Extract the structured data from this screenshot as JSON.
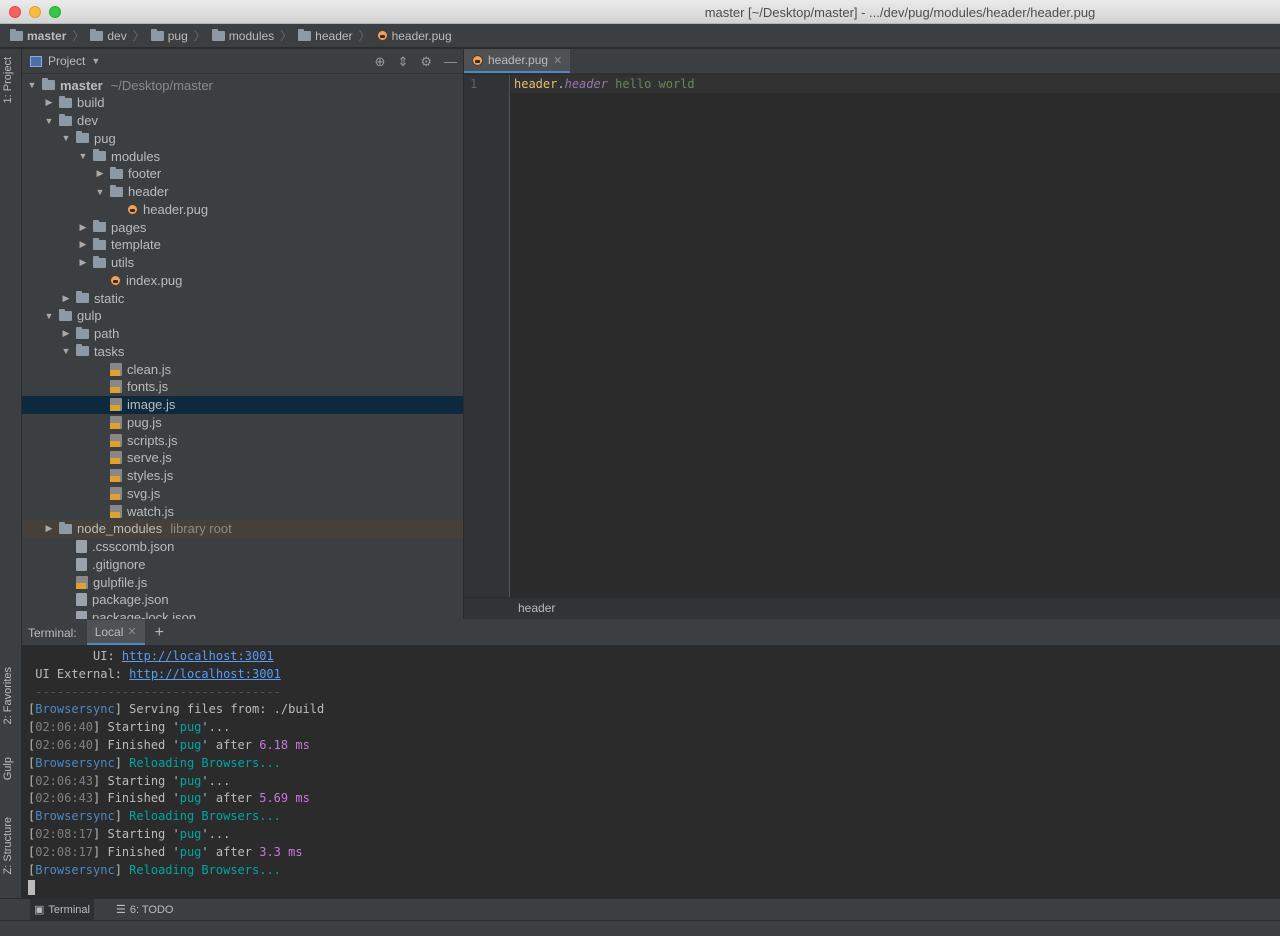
{
  "window": {
    "title": "master [~/Desktop/master] - .../dev/pug/modules/header/header.pug"
  },
  "breadcrumbs": [
    "master",
    "dev",
    "pug",
    "modules",
    "header",
    "header.pug"
  ],
  "left_tabs": {
    "project": "1: Project",
    "favorites": "2: Favorites",
    "gulp": "Gulp",
    "structure": "Z: Structure"
  },
  "project_pane": {
    "title": "Project"
  },
  "tree": [
    {
      "label": "master",
      "extra": "~/Desktop/master",
      "depth": 0,
      "kind": "folder",
      "open": true,
      "bold": true
    },
    {
      "label": "build",
      "depth": 1,
      "kind": "folder",
      "open": false
    },
    {
      "label": "dev",
      "depth": 1,
      "kind": "folder",
      "open": true
    },
    {
      "label": "pug",
      "depth": 2,
      "kind": "folder",
      "open": true
    },
    {
      "label": "modules",
      "depth": 3,
      "kind": "folder",
      "open": true
    },
    {
      "label": "footer",
      "depth": 4,
      "kind": "folder",
      "open": false
    },
    {
      "label": "header",
      "depth": 4,
      "kind": "folder",
      "open": true
    },
    {
      "label": "header.pug",
      "depth": 5,
      "kind": "pug"
    },
    {
      "label": "pages",
      "depth": 3,
      "kind": "folder",
      "open": false
    },
    {
      "label": "template",
      "depth": 3,
      "kind": "folder",
      "open": false
    },
    {
      "label": "utils",
      "depth": 3,
      "kind": "folder",
      "open": false
    },
    {
      "label": "index.pug",
      "depth": 4,
      "kind": "pug"
    },
    {
      "label": "static",
      "depth": 2,
      "kind": "folder",
      "open": false
    },
    {
      "label": "gulp",
      "depth": 1,
      "kind": "folder",
      "open": true
    },
    {
      "label": "path",
      "depth": 2,
      "kind": "folder",
      "open": false
    },
    {
      "label": "tasks",
      "depth": 2,
      "kind": "folder",
      "open": true
    },
    {
      "label": "clean.js",
      "depth": 4,
      "kind": "js"
    },
    {
      "label": "fonts.js",
      "depth": 4,
      "kind": "js"
    },
    {
      "label": "image.js",
      "depth": 4,
      "kind": "js",
      "selected": true
    },
    {
      "label": "pug.js",
      "depth": 4,
      "kind": "js"
    },
    {
      "label": "scripts.js",
      "depth": 4,
      "kind": "js"
    },
    {
      "label": "serve.js",
      "depth": 4,
      "kind": "js"
    },
    {
      "label": "styles.js",
      "depth": 4,
      "kind": "js"
    },
    {
      "label": "svg.js",
      "depth": 4,
      "kind": "js"
    },
    {
      "label": "watch.js",
      "depth": 4,
      "kind": "js"
    },
    {
      "label": "node_modules",
      "extra": "library root",
      "depth": 1,
      "kind": "folder",
      "open": false,
      "library": true
    },
    {
      "label": ".csscomb.json",
      "depth": 2,
      "kind": "file"
    },
    {
      "label": ".gitignore",
      "depth": 2,
      "kind": "file"
    },
    {
      "label": "gulpfile.js",
      "depth": 2,
      "kind": "js"
    },
    {
      "label": "package.json",
      "depth": 2,
      "kind": "file"
    },
    {
      "label": "package-lock.json",
      "depth": 2,
      "kind": "file"
    }
  ],
  "editor": {
    "tab": "header.pug",
    "line_number": "1",
    "code": {
      "tag": "header",
      "dot": ".",
      "cls": "header",
      "text": " hello world"
    },
    "status": "header"
  },
  "terminal": {
    "label": "Terminal:",
    "tab": "Local",
    "lines": [
      {
        "segs": [
          {
            "t": "         UI: ",
            "c": ""
          },
          {
            "t": "http://localhost:3001",
            "c": "lnk"
          }
        ]
      },
      {
        "segs": [
          {
            "t": " UI External: ",
            "c": ""
          },
          {
            "t": "http://localhost:3001",
            "c": "lnk"
          }
        ]
      },
      {
        "segs": [
          {
            "t": " ----------------------------------",
            "c": "gry"
          }
        ]
      },
      {
        "segs": [
          {
            "t": "[",
            "c": ""
          },
          {
            "t": "Browsersync",
            "c": "bs"
          },
          {
            "t": "] Serving files from: ./build",
            "c": ""
          }
        ]
      },
      {
        "segs": [
          {
            "t": "[",
            "c": ""
          },
          {
            "t": "02:06:40",
            "c": "ts"
          },
          {
            "t": "] Starting '",
            "c": ""
          },
          {
            "t": "pug",
            "c": "tq"
          },
          {
            "t": "'...",
            "c": ""
          }
        ]
      },
      {
        "segs": [
          {
            "t": "[",
            "c": ""
          },
          {
            "t": "02:06:40",
            "c": "ts"
          },
          {
            "t": "] Finished '",
            "c": ""
          },
          {
            "t": "pug",
            "c": "tq"
          },
          {
            "t": "' after ",
            "c": ""
          },
          {
            "t": "6.18 ms",
            "c": "num"
          }
        ]
      },
      {
        "segs": [
          {
            "t": "[",
            "c": ""
          },
          {
            "t": "Browsersync",
            "c": "bs"
          },
          {
            "t": "] ",
            "c": ""
          },
          {
            "t": "Reloading Browsers...",
            "c": "tq"
          }
        ]
      },
      {
        "segs": [
          {
            "t": "[",
            "c": ""
          },
          {
            "t": "02:06:43",
            "c": "ts"
          },
          {
            "t": "] Starting '",
            "c": ""
          },
          {
            "t": "pug",
            "c": "tq"
          },
          {
            "t": "'...",
            "c": ""
          }
        ]
      },
      {
        "segs": [
          {
            "t": "[",
            "c": ""
          },
          {
            "t": "02:06:43",
            "c": "ts"
          },
          {
            "t": "] Finished '",
            "c": ""
          },
          {
            "t": "pug",
            "c": "tq"
          },
          {
            "t": "' after ",
            "c": ""
          },
          {
            "t": "5.69 ms",
            "c": "num"
          }
        ]
      },
      {
        "segs": [
          {
            "t": "[",
            "c": ""
          },
          {
            "t": "Browsersync",
            "c": "bs"
          },
          {
            "t": "] ",
            "c": ""
          },
          {
            "t": "Reloading Browsers...",
            "c": "tq"
          }
        ]
      },
      {
        "segs": [
          {
            "t": "[",
            "c": ""
          },
          {
            "t": "02:08:17",
            "c": "ts"
          },
          {
            "t": "] Starting '",
            "c": ""
          },
          {
            "t": "pug",
            "c": "tq"
          },
          {
            "t": "'...",
            "c": ""
          }
        ]
      },
      {
        "segs": [
          {
            "t": "[",
            "c": ""
          },
          {
            "t": "02:08:17",
            "c": "ts"
          },
          {
            "t": "] Finished '",
            "c": ""
          },
          {
            "t": "pug",
            "c": "tq"
          },
          {
            "t": "' after ",
            "c": ""
          },
          {
            "t": "3.3 ms",
            "c": "num"
          }
        ]
      },
      {
        "segs": [
          {
            "t": "[",
            "c": ""
          },
          {
            "t": "Browsersync",
            "c": "bs"
          },
          {
            "t": "] ",
            "c": ""
          },
          {
            "t": "Reloading Browsers...",
            "c": "tq"
          }
        ]
      }
    ]
  },
  "bottom_tabs": {
    "terminal": "Terminal",
    "todo": "6: TODO"
  },
  "colors": {
    "selection": "#0d293e",
    "library_row": "#45403a",
    "accent": "#4a88c7"
  }
}
